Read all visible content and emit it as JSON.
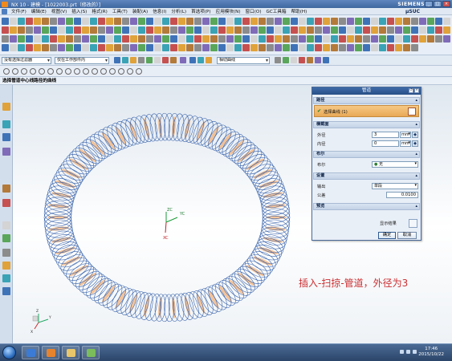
{
  "window": {
    "title": "NX 10 - 建模 - [1022003.prt（修改的）]",
    "brand": "SIEMENS"
  },
  "menu": {
    "items": [
      "文件(F)",
      "编辑(E)",
      "视图(V)",
      "插入(S)",
      "格式(R)",
      "工具(T)",
      "装配(A)",
      "信息(I)",
      "分析(L)",
      "首选项(P)",
      "应用模块(N)",
      "窗口(O)",
      "GC工具箱",
      "帮助(H)"
    ],
    "brand": "µSUC"
  },
  "selection_bar": {
    "filter": "没有选择过滤器",
    "scope": "仅在工作部件内",
    "curve_rule": "相切曲线"
  },
  "cue_line": "选择管道中心线路径的曲线",
  "dialog": {
    "title": "管道",
    "groups": {
      "path": "路径",
      "cross_section": "横截面",
      "boolean": "布尔",
      "settings": "设置",
      "preview": "预览"
    },
    "path_selector": "选择曲线 (1)",
    "outer_diameter_label": "外径",
    "outer_diameter_value": "3",
    "inner_diameter_label": "内径",
    "inner_diameter_value": "0",
    "unit": "mm",
    "boolean_label": "布尔",
    "boolean_value": "无",
    "output_label": "输出",
    "output_value": "单段",
    "tolerance_label": "公差",
    "tolerance_value": "0.0100",
    "show_result": "显示结果",
    "ok": "确定",
    "cancel": "取消"
  },
  "viewport": {
    "triad_labels": [
      "ZC",
      "YC",
      "XC"
    ],
    "corner_axes": [
      "Z",
      "Y",
      "X"
    ],
    "coil_color": "#2f5ca8",
    "highlight_color": "#f2b27a"
  },
  "annotation": "插入-扫掠-管道，外径为3",
  "taskbar": {
    "time": "17:46",
    "date": "2015/10/22"
  }
}
